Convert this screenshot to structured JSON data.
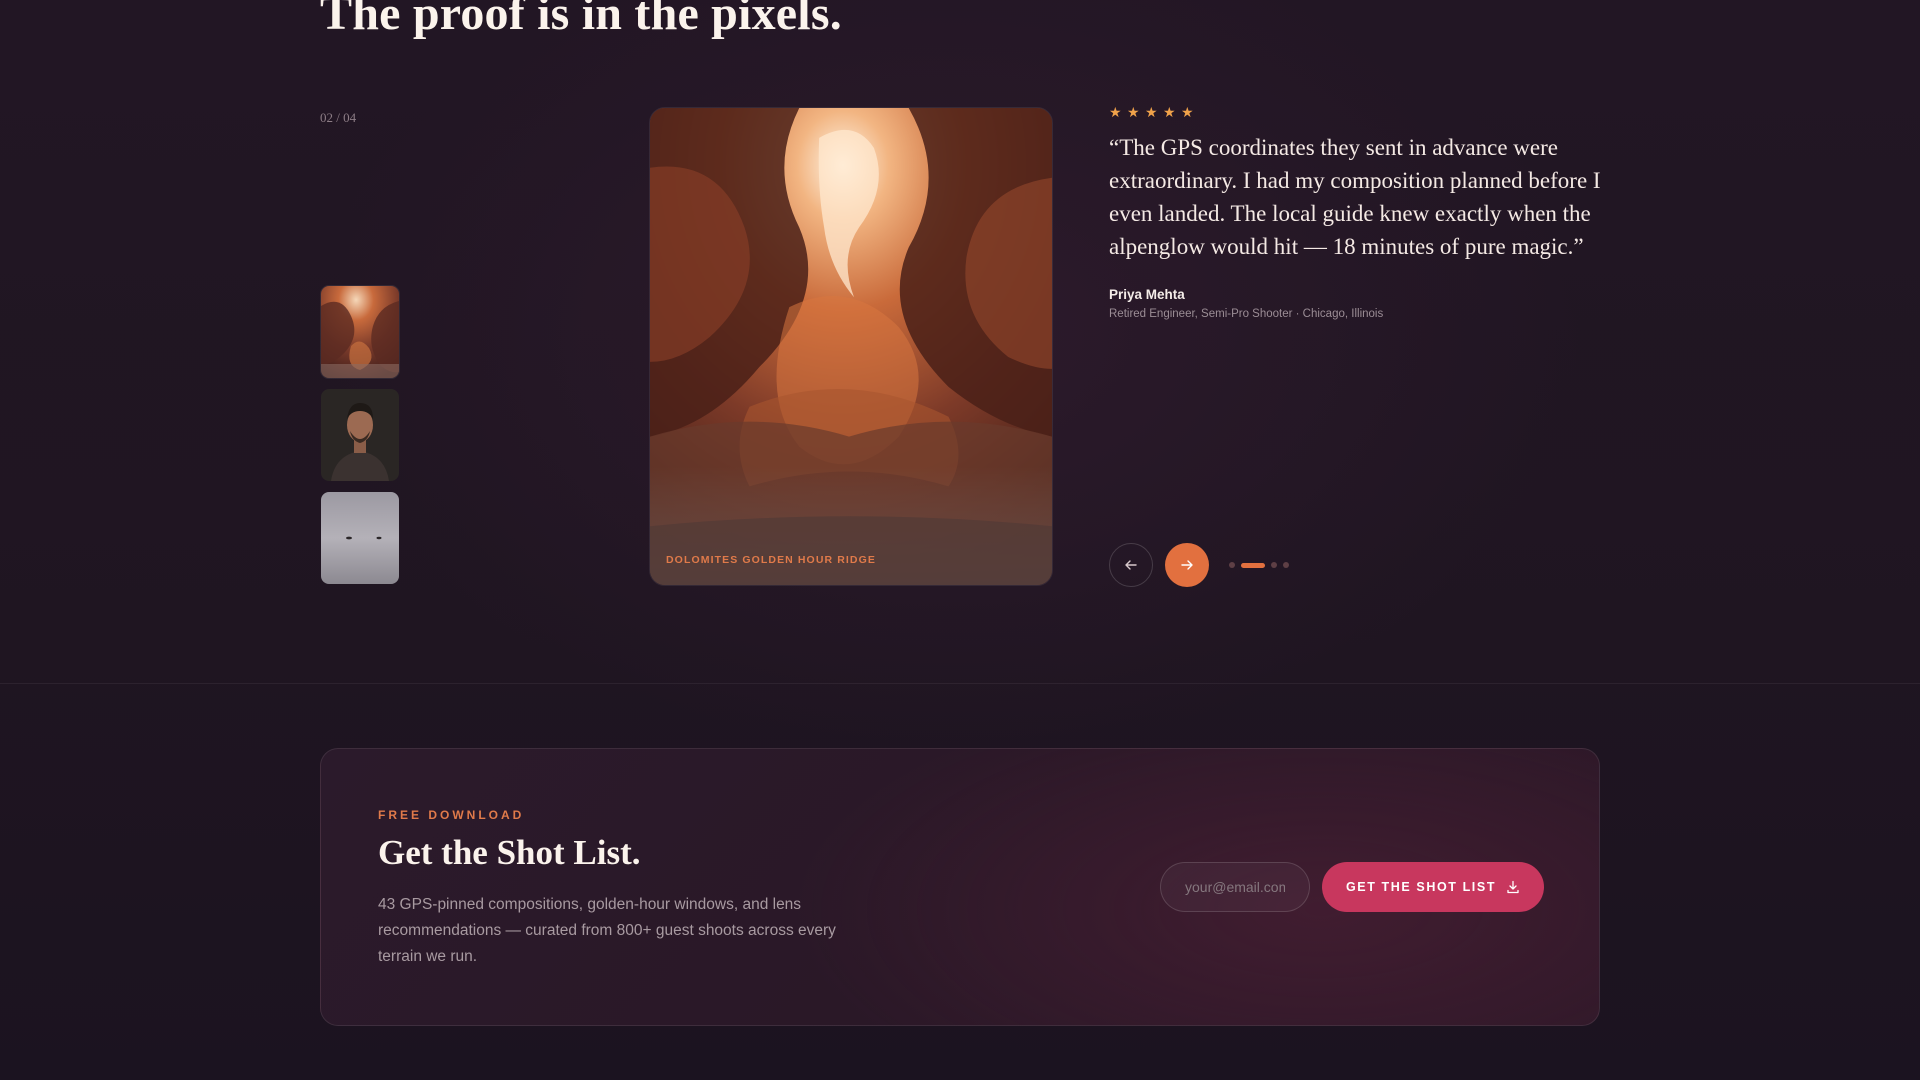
{
  "section": {
    "headline": "The proof is in the pixels."
  },
  "gallery": {
    "counter": "02 / 04",
    "thumbnails": [
      {
        "name": "canyon-thumbnail"
      },
      {
        "name": "portrait-thumbnail"
      },
      {
        "name": "misty-lake-thumbnail"
      }
    ],
    "hero_caption": "DOLOMITES GOLDEN HOUR RIDGE"
  },
  "testimonial": {
    "rating": 5,
    "stars": [
      "★",
      "★",
      "★",
      "★",
      "★"
    ],
    "quote": "“The GPS coordinates they sent in advance were extraordinary. I had my composition planned before I even landed. The local guide knew exactly when the alpenglow would hit — 18 minutes of pure magic.”",
    "author": "Priya Mehta",
    "role": "Retired Engineer, Semi-Pro Shooter · Chicago, Illinois"
  },
  "carousel": {
    "prev_icon": "arrow-left-icon",
    "next_icon": "arrow-right-icon",
    "total": 4,
    "active_index": 2
  },
  "cta": {
    "eyebrow": "FREE DOWNLOAD",
    "title": "Get the Shot List.",
    "description": "43 GPS-pinned compositions, golden-hour windows, and lens recommendations — curated from 800+ guest shoots across every terrain we run.",
    "email_placeholder": "your@email.com",
    "button_label": "GET THE SHOT LIST",
    "button_icon": "download-icon"
  },
  "colors": {
    "accent_orange": "#e2703f",
    "accent_pink": "#c8375e",
    "star": "#f0a24a",
    "background": "#1d1420"
  }
}
